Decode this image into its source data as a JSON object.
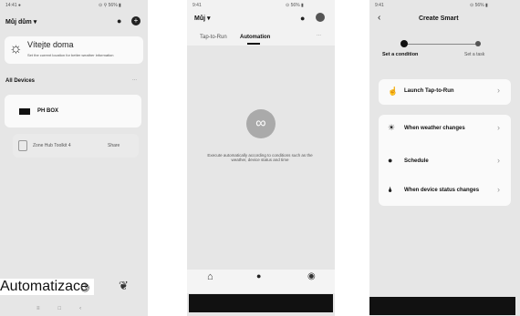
{
  "screen1": {
    "status_time": "14:41 ●",
    "status_icons": "⊙ ⚲ 56% ▮",
    "home_selector": "Můj dům ▾",
    "greeting": "Vítejte doma",
    "hint": "Set the current location for better weather information",
    "devices_heading": "All Devices",
    "device1_name": "PH BOX",
    "device2_name": "Zone Hub Toolkit 4",
    "device2_action": "Share",
    "bottom_caption": "Automatizace"
  },
  "screen2": {
    "status_time": "9:41",
    "status_icons": "⊙ 56% ▮",
    "home_selector": "Můj ▾",
    "tab1": "Tap-to-Run",
    "tab2": "Automation",
    "empty_text": "Execute automatically according to conditions such as the weather, device status and time",
    "nav_icons": [
      "home-icon",
      "scene-icon",
      "me-icon"
    ]
  },
  "screen3": {
    "status_time": "9:41",
    "status_icons": "⊙ 56% ▮",
    "title": "Create Smart",
    "step1": "Set a condition",
    "step2": "Set a task",
    "options": [
      "Launch Tap-to-Run",
      "When weather changes",
      "Schedule",
      "When device status changes"
    ]
  }
}
